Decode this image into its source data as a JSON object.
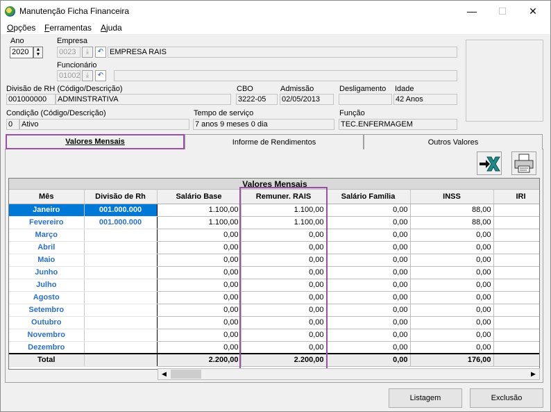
{
  "window": {
    "title": "Manutenção Ficha Financeira",
    "minimize": "—",
    "maximize": "☐",
    "close": "✕"
  },
  "menu": [
    {
      "label": "Opções",
      "u": "O",
      "rest": "pções"
    },
    {
      "label": "Ferramentas",
      "u": "F",
      "rest": "erramentas"
    },
    {
      "label": "Ajuda",
      "u": "A",
      "rest": "juda"
    }
  ],
  "form": {
    "ano_label": "Ano",
    "ano_value": "2020",
    "empresa_label": "Empresa",
    "empresa_code": "0023",
    "empresa_name": "EMPRESA RAIS",
    "funcionario_label": "Funcionário",
    "funcionario_code": "01002",
    "funcionario_name": "",
    "divisao_label": "Divisão de RH (Código/Descrição)",
    "divisao_code": "001000000",
    "divisao_desc": "ADMINSTRATIVA",
    "cbo_label": "CBO",
    "cbo_value": "3222-05",
    "admissao_label": "Admissão",
    "admissao_value": "02/05/2013",
    "desligamento_label": "Desligamento",
    "desligamento_value": "",
    "idade_label": "Idade",
    "idade_value": "42 Anos",
    "condicao_label": "Condição (Código/Descrição)",
    "condicao_code": "0",
    "condicao_desc": "Ativo",
    "tempo_label": "Tempo de serviço",
    "tempo_value": "7 anos 9 meses 0 dia",
    "funcao_label": "Função",
    "funcao_value": "TEC.ENFERMAGEM"
  },
  "tabs": [
    {
      "label": "Valores Mensais",
      "active": true
    },
    {
      "label": "Informe de Rendimentos",
      "active": false
    },
    {
      "label": "Outros Valores",
      "active": false
    }
  ],
  "toolbar": {
    "excel_icon": "excel-export-icon",
    "print_icon": "printer-icon"
  },
  "grid": {
    "title": "Valores Mensais",
    "columns": [
      "Mês",
      "Divisão de Rh",
      "Salário Base",
      "Remuner. RAIS",
      "Salário Família",
      "INSS",
      "IRI"
    ],
    "rows": [
      {
        "mes": "Janeiro",
        "divisao": "001.000.000",
        "salario": "1.100,00",
        "rais": "1.100,00",
        "familia": "0,00",
        "inss": "88,00",
        "irrf": ""
      },
      {
        "mes": "Fevereiro",
        "divisao": "001.000.000",
        "salario": "1.100,00",
        "rais": "1.100,00",
        "familia": "0,00",
        "inss": "88,00",
        "irrf": ""
      },
      {
        "mes": "Março",
        "divisao": "",
        "salario": "0,00",
        "rais": "0,00",
        "familia": "0,00",
        "inss": "0,00",
        "irrf": ""
      },
      {
        "mes": "Abril",
        "divisao": "",
        "salario": "0,00",
        "rais": "0,00",
        "familia": "0,00",
        "inss": "0,00",
        "irrf": ""
      },
      {
        "mes": "Maio",
        "divisao": "",
        "salario": "0,00",
        "rais": "0,00",
        "familia": "0,00",
        "inss": "0,00",
        "irrf": ""
      },
      {
        "mes": "Junho",
        "divisao": "",
        "salario": "0,00",
        "rais": "0,00",
        "familia": "0,00",
        "inss": "0,00",
        "irrf": ""
      },
      {
        "mes": "Julho",
        "divisao": "",
        "salario": "0,00",
        "rais": "0,00",
        "familia": "0,00",
        "inss": "0,00",
        "irrf": ""
      },
      {
        "mes": "Agosto",
        "divisao": "",
        "salario": "0,00",
        "rais": "0,00",
        "familia": "0,00",
        "inss": "0,00",
        "irrf": ""
      },
      {
        "mes": "Setembro",
        "divisao": "",
        "salario": "0,00",
        "rais": "0,00",
        "familia": "0,00",
        "inss": "0,00",
        "irrf": ""
      },
      {
        "mes": "Outubro",
        "divisao": "",
        "salario": "0,00",
        "rais": "0,00",
        "familia": "0,00",
        "inss": "0,00",
        "irrf": ""
      },
      {
        "mes": "Novembro",
        "divisao": "",
        "salario": "0,00",
        "rais": "0,00",
        "familia": "0,00",
        "inss": "0,00",
        "irrf": ""
      },
      {
        "mes": "Dezembro",
        "divisao": "",
        "salario": "0,00",
        "rais": "0,00",
        "familia": "0,00",
        "inss": "0,00",
        "irrf": ""
      }
    ],
    "total": {
      "mes": "Total",
      "divisao": "",
      "salario": "2.200,00",
      "rais": "2.200,00",
      "familia": "0,00",
      "inss": "176,00",
      "irrf": ""
    }
  },
  "buttons": {
    "listagem": "Listagem",
    "exclusao": "Exclusão"
  },
  "colors": {
    "selection": "#0078d7",
    "highlight": "#9b4fa8",
    "month_text": "#2a6fd0"
  }
}
